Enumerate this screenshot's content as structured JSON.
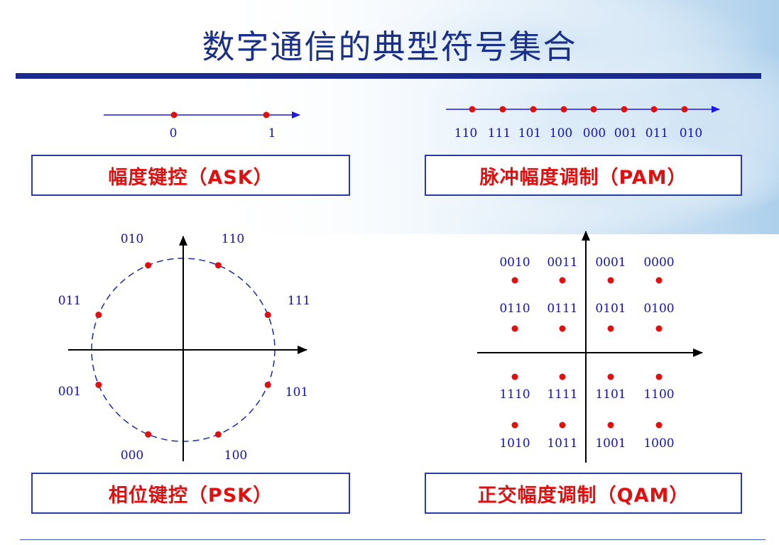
{
  "title": "数字通信的典型符号集合",
  "colors": {
    "title": "#1a2f88",
    "rule": "#1b2a8f",
    "point": "#e01010",
    "label": "#1212b8",
    "caption_text": "#e01010",
    "caption_border": "#2a3aa8",
    "axis": "#000000",
    "number_line": "#1a1ae0"
  },
  "ask": {
    "caption": "幅度键控（ASK）",
    "points": [
      "0",
      "1"
    ]
  },
  "pam": {
    "caption": "脉冲幅度调制（PAM）",
    "points": [
      "110",
      "111",
      "101",
      "100",
      "000",
      "001",
      "011",
      "010"
    ]
  },
  "psk": {
    "caption": "相位键控（PSK）",
    "points": [
      "110",
      "111",
      "101",
      "100",
      "000",
      "001",
      "011",
      "010"
    ]
  },
  "qam": {
    "caption": "正交幅度调制（QAM）",
    "rows": [
      [
        "0010",
        "0011",
        "0001",
        "0000"
      ],
      [
        "0110",
        "0111",
        "0101",
        "0100"
      ],
      [
        "1110",
        "1111",
        "1101",
        "1100"
      ],
      [
        "1010",
        "1011",
        "1001",
        "1000"
      ]
    ]
  }
}
